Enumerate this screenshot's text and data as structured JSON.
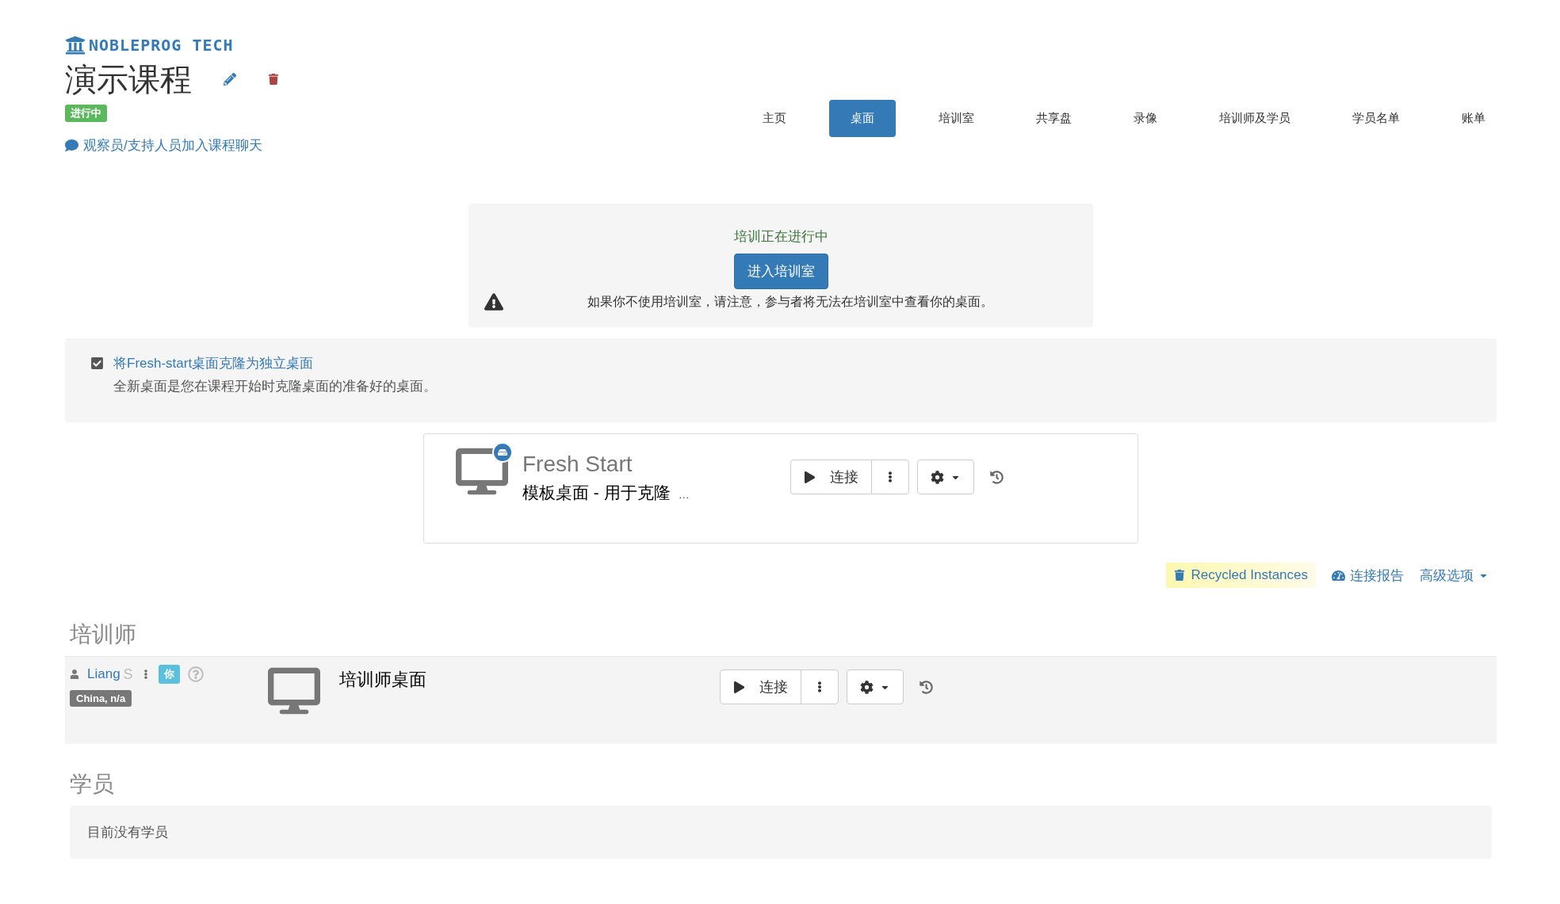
{
  "brand": {
    "name": "NOBLEPROG TECH"
  },
  "course": {
    "title": "演示课程",
    "status": "进行中",
    "chat_link": "观察员/支持人员加入课程聊天"
  },
  "tabs": [
    {
      "label": "主页",
      "selected": false
    },
    {
      "label": "桌面",
      "selected": true
    },
    {
      "label": "培训室",
      "selected": false
    },
    {
      "label": "共享盘",
      "selected": false
    },
    {
      "label": "录像",
      "selected": false
    },
    {
      "label": "培训师及学员",
      "selected": false
    },
    {
      "label": "学员名单",
      "selected": false
    },
    {
      "label": "账单",
      "selected": false
    }
  ],
  "notice": {
    "status": "培训正在进行中",
    "button": "进入培训室",
    "warning": "如果你不使用培训室，请注意，参与者将无法在培训室中查看你的桌面。"
  },
  "clone_option": {
    "checked": true,
    "label": "将Fresh-start桌面克隆为独立桌面",
    "description": "全新桌面是您在课程开始时克隆桌面的准备好的桌面。"
  },
  "template_desktop": {
    "name": "Fresh Start",
    "subtitle": "模板桌面 - 用于克隆",
    "more": "…",
    "connect": "连接"
  },
  "links": [
    {
      "kind": "recycled",
      "label": "Recycled Instances"
    },
    {
      "kind": "report",
      "label": "连接报告"
    },
    {
      "kind": "dropdown",
      "label": "高级选项"
    }
  ],
  "trainers": {
    "heading": "培训师",
    "rows": [
      {
        "name": "Liang",
        "surname": "S",
        "you_badge": "你",
        "location": "China, n/a",
        "desktop": "培训师桌面",
        "connect": "连接"
      }
    ]
  },
  "students": {
    "heading": "学员",
    "empty": "目前没有学员"
  }
}
